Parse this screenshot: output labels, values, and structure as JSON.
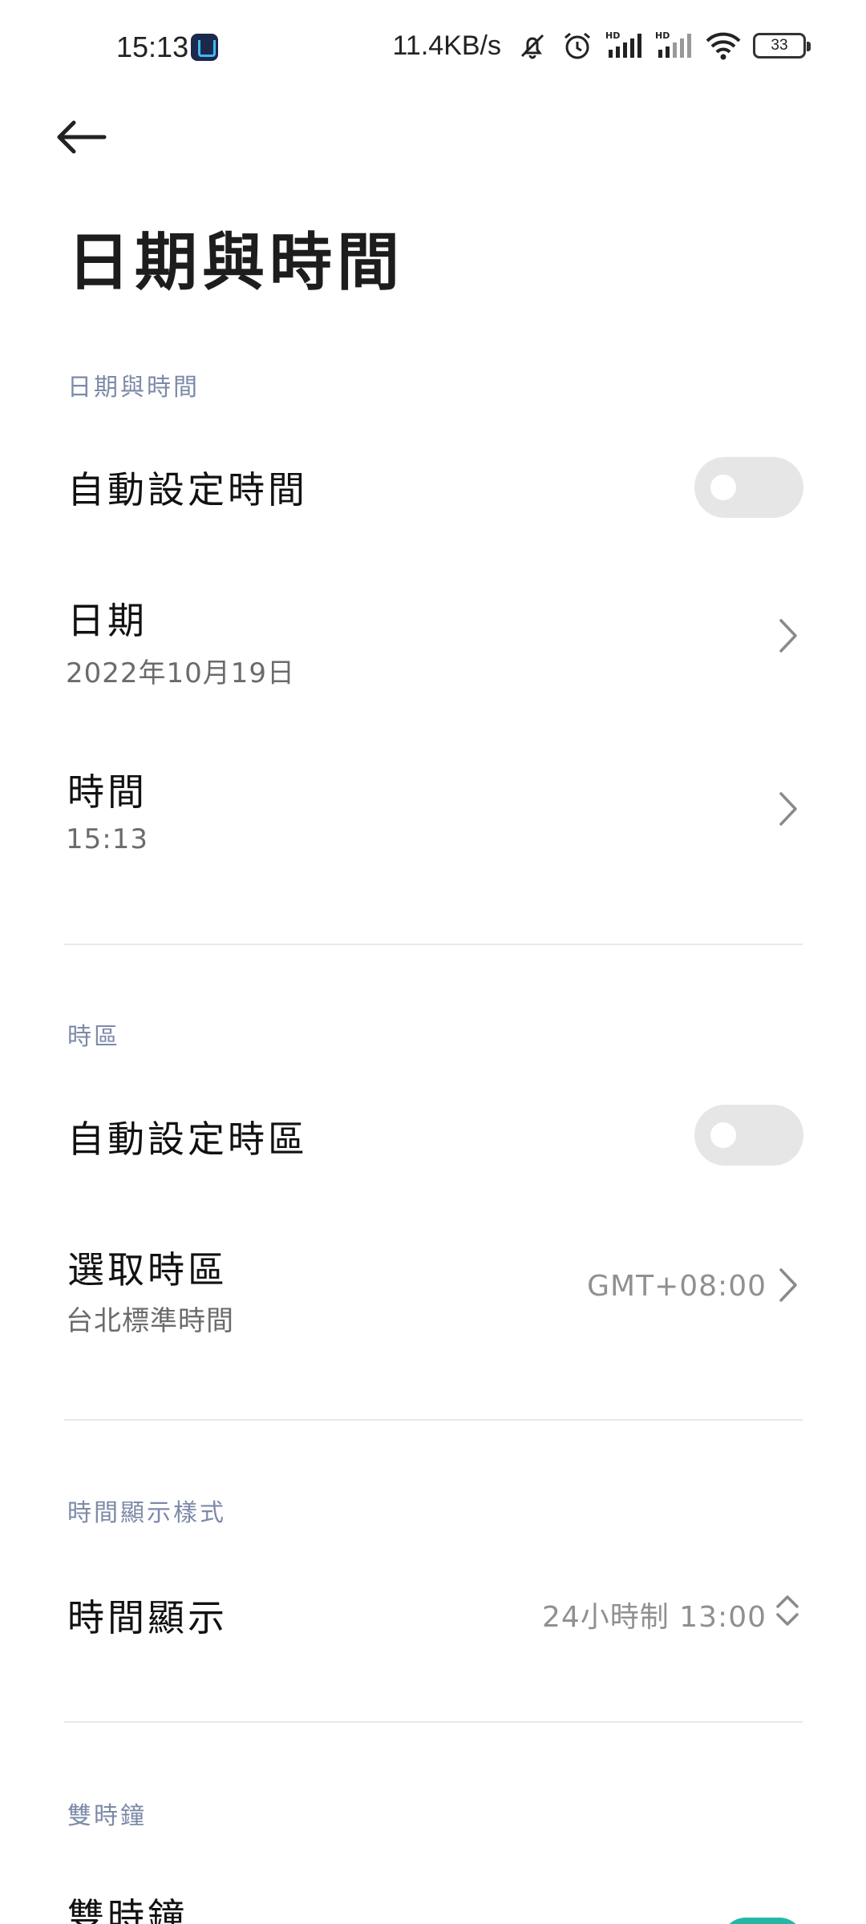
{
  "status_bar": {
    "time": "15:13",
    "speed": "11.4KB/s",
    "battery": "33",
    "icons": [
      "app-icon",
      "mute-icon",
      "alarm-icon",
      "hd-signal-icon",
      "hd-signal-icon",
      "wifi-icon",
      "battery-icon"
    ]
  },
  "header": {
    "title": "日期與時間"
  },
  "sections": {
    "date_time": {
      "label": "日期與時間",
      "auto_time_label": "自動設定時間",
      "auto_time_on": false,
      "date_label": "日期",
      "date_value": "2022年10月19日",
      "time_label": "時間",
      "time_value": "15:13"
    },
    "timezone": {
      "label": "時區",
      "auto_zone_label": "自動設定時區",
      "auto_zone_on": false,
      "select_zone_label": "選取時區",
      "select_zone_sub": "台北標準時間",
      "select_zone_value": "GMT+08:00"
    },
    "time_format": {
      "label": "時間顯示樣式",
      "display_label": "時間顯示",
      "display_value": "24小時制 13:00"
    },
    "dual_clock": {
      "label": "雙時鐘",
      "title": "雙時鐘"
    }
  },
  "colors": {
    "section_label": "#7d8aa8",
    "toggle_off": "#e6e6e6",
    "accent": "#26b6a6"
  }
}
